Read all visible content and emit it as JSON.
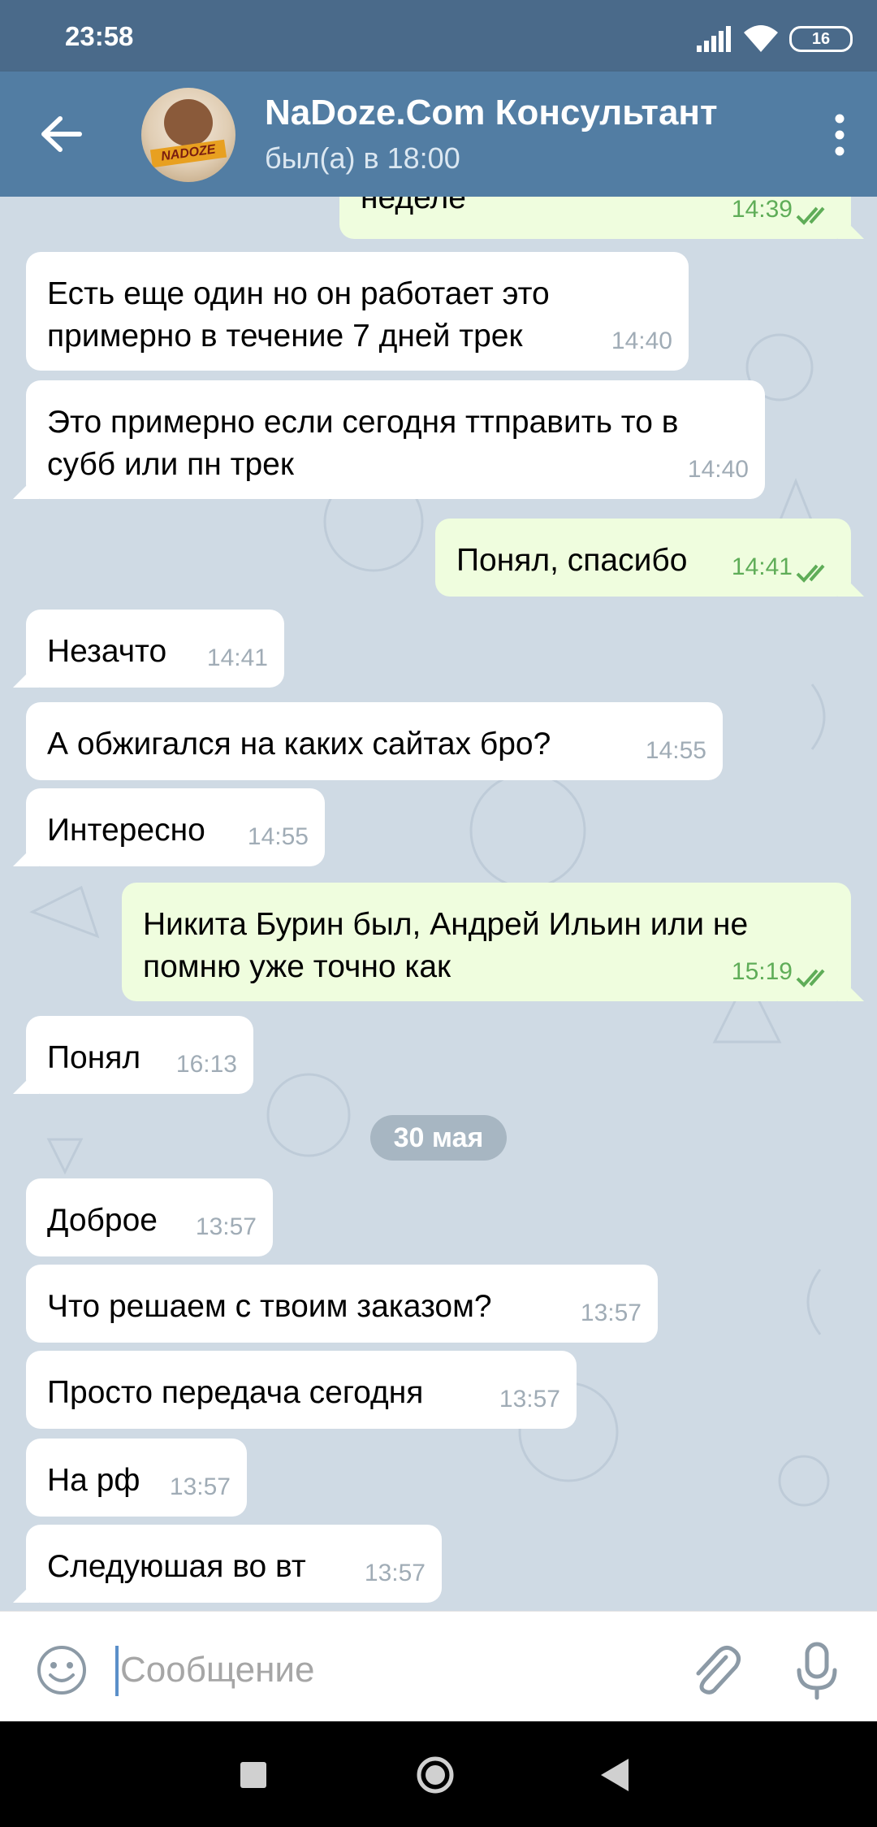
{
  "status_bar": {
    "time": "23:58",
    "battery": "16"
  },
  "header": {
    "title": "NaDoze.Com Консультант",
    "subtitle": "был(а) в 18:00",
    "avatar_text": "NADOZE"
  },
  "messages": [
    {
      "dir": "out",
      "text": "неделе",
      "time": "14:39"
    },
    {
      "dir": "in",
      "text": "Есть еще один но он работает это примерно в течение 7 дней трек",
      "time": "14:40"
    },
    {
      "dir": "in",
      "text": "Это примерно если сегодня ттправить то в субб или пн трек",
      "time": "14:40"
    },
    {
      "dir": "out",
      "text": "Понял, спасибо",
      "time": "14:41"
    },
    {
      "dir": "in",
      "text": "Незачто",
      "time": "14:41"
    },
    {
      "dir": "in",
      "text": "А обжигался на каких сайтах бро?",
      "time": "14:55"
    },
    {
      "dir": "in",
      "text": "Интересно",
      "time": "14:55"
    },
    {
      "dir": "out",
      "text": "Никита Бурин был, Андрей Ильин или не помню уже точно как",
      "time": "15:19"
    },
    {
      "dir": "in",
      "text": "Понял",
      "time": "16:13"
    },
    {
      "dir": "in",
      "text": "Доброе",
      "time": "13:57"
    },
    {
      "dir": "in",
      "text": "Что решаем с твоим заказом?",
      "time": "13:57"
    },
    {
      "dir": "in",
      "text": "Просто передача сегодня",
      "time": "13:57"
    },
    {
      "dir": "in",
      "text": "На рф",
      "time": "13:57"
    },
    {
      "dir": "in",
      "text": "Следуюшая во вт",
      "time": "13:57"
    }
  ],
  "date_badge": "30 мая",
  "composer": {
    "placeholder": "Сообщение"
  },
  "colors": {
    "header_bg": "#527da3",
    "statusbar_bg": "#4a6a8a",
    "chat_bg": "#cfdae4",
    "incoming_bubble": "#ffffff",
    "outgoing_bubble": "#effdde",
    "outgoing_time": "#5fad58"
  },
  "icons": {
    "back": "arrow-left-icon",
    "menu": "more-vertical-icon",
    "emoji": "smiley-icon",
    "attach": "paperclip-icon",
    "mic": "microphone-icon",
    "read": "double-check-icon"
  }
}
